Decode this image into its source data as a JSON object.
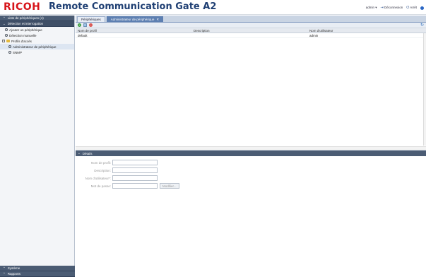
{
  "header": {
    "brand": "RICOH",
    "product": "Remote Communication Gate A2",
    "user": "admin",
    "logout": "Déconnexion",
    "stop": "Arrêt"
  },
  "sidebar": {
    "sections": {
      "devices": "Liste de périphériques (4)",
      "discovery": "Détection et interrogation",
      "system": "Système",
      "extra": "Rapports"
    },
    "items": [
      {
        "label": "Ajouter un périphérique"
      },
      {
        "label": "Détection manuelle"
      },
      {
        "label": "Profils d'accès"
      },
      {
        "label": "Administrateur de périphérique"
      },
      {
        "label": "SNMP"
      }
    ]
  },
  "tabs": [
    {
      "label": "Périphériques"
    },
    {
      "label": "Administrateur de périphérique"
    }
  ],
  "grid": {
    "columns": [
      "Nom de profil",
      "Description",
      "Nom d'utilisateur"
    ],
    "rows": [
      {
        "name": "default",
        "description": "",
        "user": "admin"
      }
    ]
  },
  "details": {
    "title": "Détails",
    "fields": {
      "profile_name": "Nom de profil:",
      "description": "Description:",
      "username": "Nom d'utilisateur*:",
      "password": "Mot de passe:"
    },
    "modify_button": "Modifier..."
  }
}
